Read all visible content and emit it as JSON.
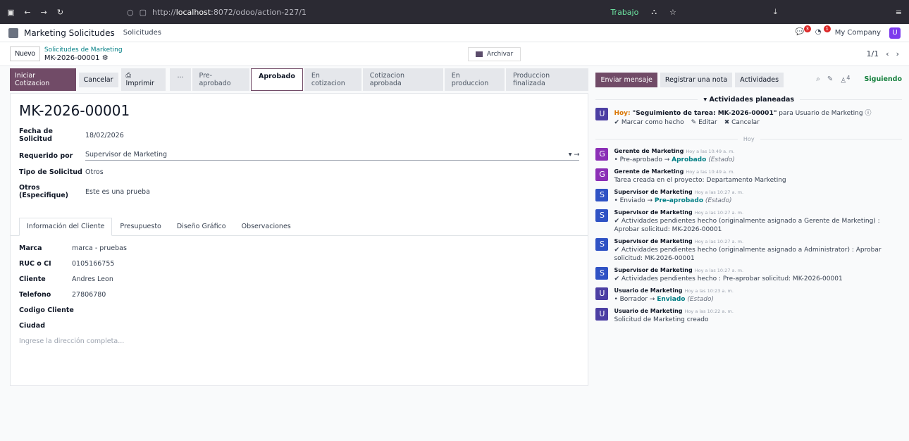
{
  "browser": {
    "url_prefix": "http://",
    "url_host": "localhost",
    "url_rest": ":8072/odoo/action-227/1",
    "workspace": "Trabajo"
  },
  "app": {
    "title": "Marketing Solicitudes",
    "menu": "Solicitudes",
    "chat_count": "3",
    "activity_count": "1",
    "company": "My Company",
    "user_initial": "U"
  },
  "control": {
    "new_label": "Nuevo",
    "breadcrumb_parent": "Solicitudes de Marketing",
    "breadcrumb_current": "MK-2026-00001",
    "archive_label": "Archivar",
    "pager": "1/1"
  },
  "actions": {
    "iniciar": "Iniciar Cotizacion",
    "cancelar": "Cancelar",
    "imprimir": "Imprimir"
  },
  "stages": [
    "...",
    "Pre-aprobado",
    "Aprobado",
    "En cotizacion",
    "Cotizacion aprobada",
    "En produccion",
    "Produccion finalizada"
  ],
  "record": {
    "name": "MK-2026-00001",
    "fields": [
      {
        "label": "Fecha de Solicitud",
        "value": "18/02/2026"
      },
      {
        "label": "Requerido por",
        "value": "Supervisor de Marketing"
      },
      {
        "label": "Tipo de Solicitud",
        "value": "Otros"
      },
      {
        "label": "Otros (Especifique)",
        "value": "Este es una prueba"
      }
    ]
  },
  "tabs": [
    "Información del Cliente",
    "Presupuesto",
    "Diseño Gráfico",
    "Observaciones"
  ],
  "client": {
    "fields": [
      {
        "label": "Marca",
        "value": "marca - pruebas"
      },
      {
        "label": "RUC o CI",
        "value": "0105166755"
      },
      {
        "label": "Cliente",
        "value": "Andres Leon"
      },
      {
        "label": "Telefono",
        "value": "27806780"
      },
      {
        "label": "Codigo Cliente",
        "value": ""
      },
      {
        "label": "Ciudad",
        "value": ""
      }
    ],
    "address_placeholder": "Ingrese la dirección completa..."
  },
  "chatter": {
    "send": "Enviar mensaje",
    "note": "Registrar una nota",
    "activities": "Actividades",
    "attach_count": "4",
    "following": "Siguiendo",
    "planned_title": "Actividades planeadas",
    "activity": {
      "initial": "U",
      "when": "Hoy:",
      "summary": "\"Seguimiento de tarea: MK-2026-00001\"",
      "for": "para Usuario de Marketing",
      "done": "Marcar como hecho",
      "edit": "Editar",
      "cancel": "Cancelar"
    },
    "day_sep": "Hoy",
    "messages": [
      {
        "initial": "G",
        "color": "g",
        "author": "Gerente de Marketing",
        "time": "Hoy a las 10:49 a. m.",
        "old": "Pre-aprobado",
        "new": "Aprobado",
        "field": "(Estado)"
      },
      {
        "initial": "G",
        "color": "g",
        "author": "Gerente de Marketing",
        "time": "Hoy a las 10:49 a. m.",
        "text": "Tarea creada en el proyecto: Departamento Marketing"
      },
      {
        "initial": "S",
        "color": "s",
        "author": "Supervisor de Marketing",
        "time": "Hoy a las 10:27 a. m.",
        "old": "Enviado",
        "new": "Pre-aprobado",
        "field": "(Estado)"
      },
      {
        "initial": "S",
        "color": "s",
        "author": "Supervisor de Marketing",
        "time": "Hoy a las 10:27 a. m.",
        "text": "✔ Actividades pendientes hecho (originalmente asignado a Gerente de Marketing) : Aprobar solicitud: MK-2026-00001"
      },
      {
        "initial": "S",
        "color": "s",
        "author": "Supervisor de Marketing",
        "time": "Hoy a las 10:27 a. m.",
        "text": "✔ Actividades pendientes hecho (originalmente asignado a Administrator) : Aprobar solicitud: MK-2026-00001"
      },
      {
        "initial": "S",
        "color": "s",
        "author": "Supervisor de Marketing",
        "time": "Hoy a las 10:27 a. m.",
        "text": "✔ Actividades pendientes hecho : Pre-aprobar solicitud: MK-2026-00001"
      },
      {
        "initial": "U",
        "color": "u",
        "author": "Usuario de Marketing",
        "time": "Hoy a las 10:23 a. m.",
        "old": "Borrador",
        "new": "Enviado",
        "field": "(Estado)"
      },
      {
        "initial": "U",
        "color": "u",
        "author": "Usuario de Marketing",
        "time": "Hoy a las 10:22 a. m.",
        "text": "Solicitud de Marketing creado"
      }
    ]
  }
}
